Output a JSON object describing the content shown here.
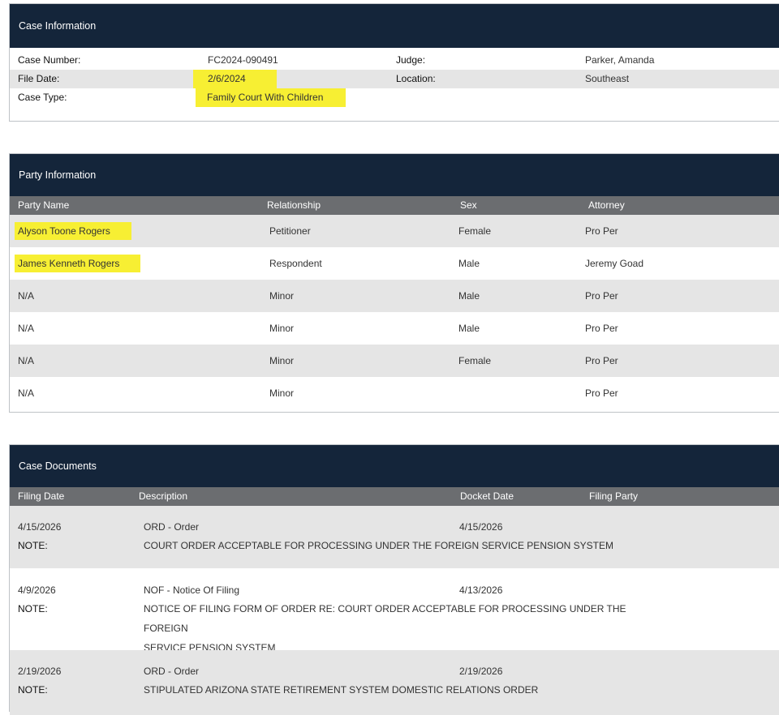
{
  "case_info": {
    "title": "Case Information",
    "case_number_label": "Case Number:",
    "case_number": "FC2024-090491",
    "judge_label": "Judge:",
    "judge": "Parker, Amanda",
    "file_date_label": "File Date:",
    "file_date": "2/6/2024",
    "location_label": "Location:",
    "location": "Southeast",
    "case_type_label": "Case Type:",
    "case_type": "Family Court With Children"
  },
  "party_info": {
    "title": "Party Information",
    "columns": [
      "Party Name",
      "Relationship",
      "Sex",
      "Attorney"
    ],
    "rows": [
      {
        "name": "Alyson Toone Rogers",
        "relationship": "Petitioner",
        "sex": "Female",
        "attorney": "Pro Per"
      },
      {
        "name": "James Kenneth Rogers",
        "relationship": "Respondent",
        "sex": "Male",
        "attorney": "Jeremy Goad"
      },
      {
        "name": "N/A",
        "relationship": "Minor",
        "sex": "Male",
        "attorney": "Pro Per"
      },
      {
        "name": "N/A",
        "relationship": "Minor",
        "sex": "Male",
        "attorney": "Pro Per"
      },
      {
        "name": "N/A",
        "relationship": "Minor",
        "sex": "Female",
        "attorney": "Pro Per"
      },
      {
        "name": "N/A",
        "relationship": "Minor",
        "sex": "",
        "attorney": "Pro Per"
      }
    ]
  },
  "case_docs": {
    "title": "Case Documents",
    "columns": [
      "Filing Date",
      "Description",
      "Docket Date",
      "Filing Party"
    ],
    "note_label": "NOTE:",
    "rows": [
      {
        "filing_date": "4/15/2026",
        "description": "ORD - Order",
        "docket_date": "4/15/2026",
        "note_line1": "COURT ORDER ACCEPTABLE FOR PROCESSING UNDER THE FOREIGN SERVICE PENSION SYSTEM",
        "note_line2": ""
      },
      {
        "filing_date": "4/9/2026",
        "description": "NOF - Notice Of Filing",
        "docket_date": "4/13/2026",
        "note_line1": "NOTICE OF FILING FORM OF ORDER RE: COURT ORDER ACCEPTABLE FOR PROCESSING UNDER THE FOREIGN",
        "note_line2": "SERVICE PENSION SYSTEM"
      },
      {
        "filing_date": "2/19/2026",
        "description": "ORD - Order",
        "docket_date": "2/19/2026",
        "note_line1": "STIPULATED ARIZONA STATE RETIREMENT SYSTEM DOMESTIC RELATIONS ORDER",
        "note_line2": ""
      }
    ]
  },
  "colors": {
    "header_bg": "#14253a",
    "column_head_bg": "#6b6d70",
    "row_shade": "#e5e5e5",
    "highlight": "#f7ef33"
  }
}
